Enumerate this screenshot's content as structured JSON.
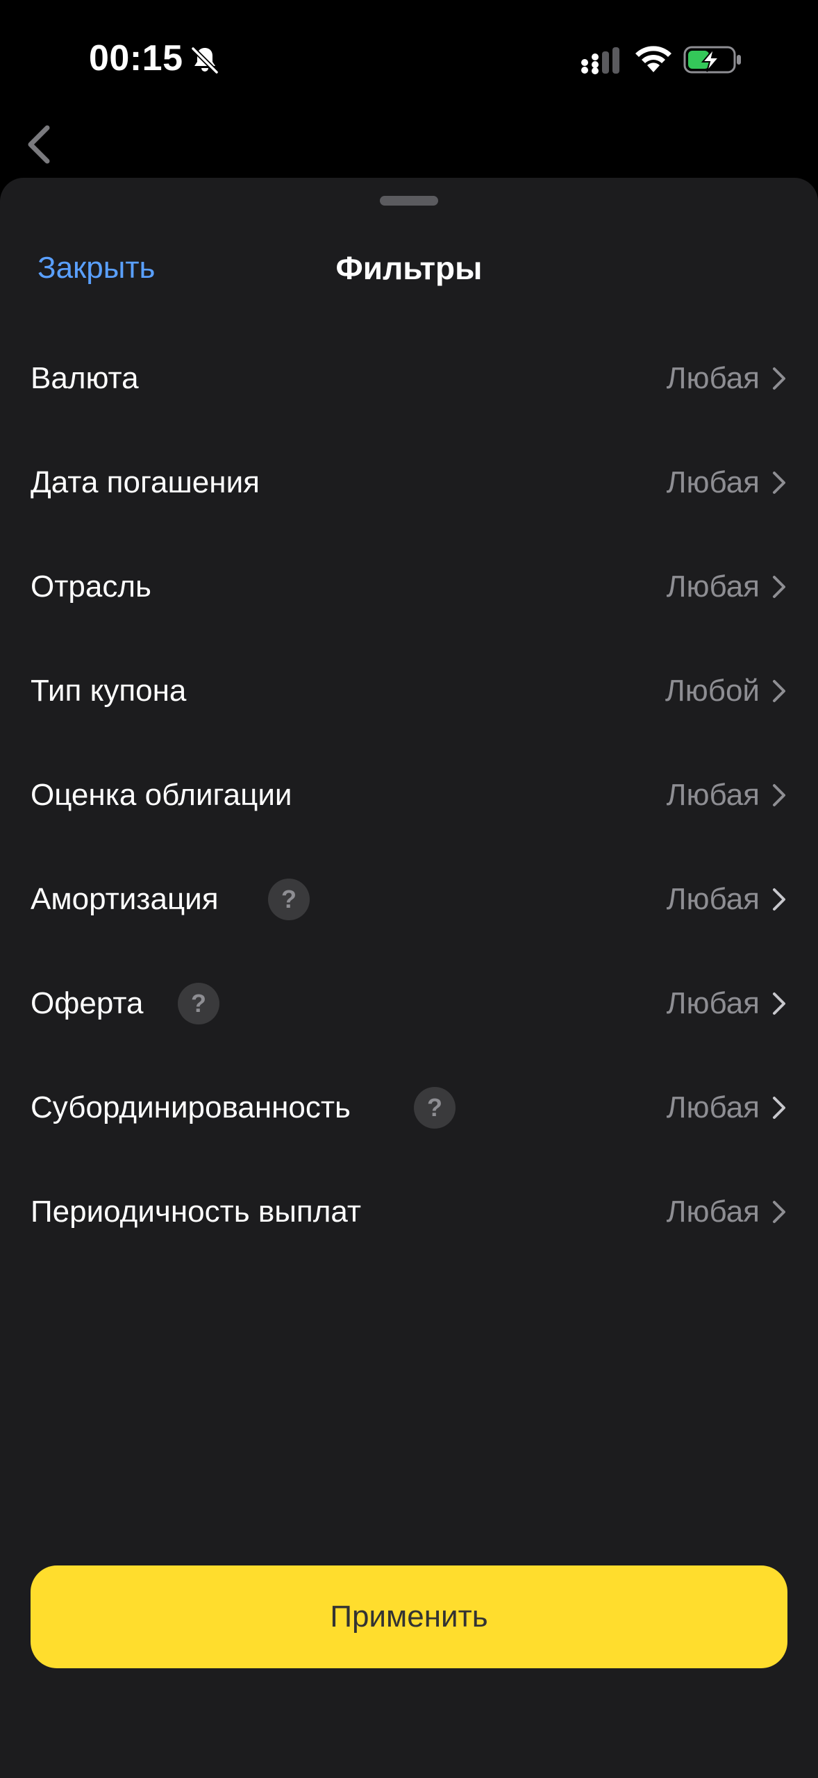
{
  "status_bar": {
    "time": "00:15",
    "icons": [
      "bell-slash-icon",
      "signal-icon",
      "wifi-icon",
      "battery-charging-icon"
    ]
  },
  "nav": {
    "back_icon": "chevron-left-icon"
  },
  "sheet": {
    "close_label": "Закрыть",
    "title": "Фильтры",
    "filters": [
      {
        "label": "Валюта",
        "value": "Любая",
        "help": false
      },
      {
        "label": "Дата погашения",
        "value": "Любая",
        "help": false
      },
      {
        "label": "Отрасль",
        "value": "Любая",
        "help": false
      },
      {
        "label": "Тип купона",
        "value": "Любой",
        "help": false
      },
      {
        "label": "Оценка облигации",
        "value": "Любая",
        "help": false
      },
      {
        "label": "Амортизация",
        "value": "Любая",
        "help": true
      },
      {
        "label": "Оферта",
        "value": "Любая",
        "help": true
      },
      {
        "label": "Субординированность",
        "value": "Любая",
        "help": true
      },
      {
        "label": "Периодичность выплат",
        "value": "Любая",
        "help": false
      }
    ],
    "help_symbol": "?",
    "apply_label": "Применить"
  },
  "colors": {
    "background": "#000000",
    "sheet": "#1c1c1e",
    "accent_link": "#5aa0ff",
    "primary_button": "#ffdd2d",
    "secondary_text": "#8e8e93",
    "battery_green": "#34c759"
  }
}
